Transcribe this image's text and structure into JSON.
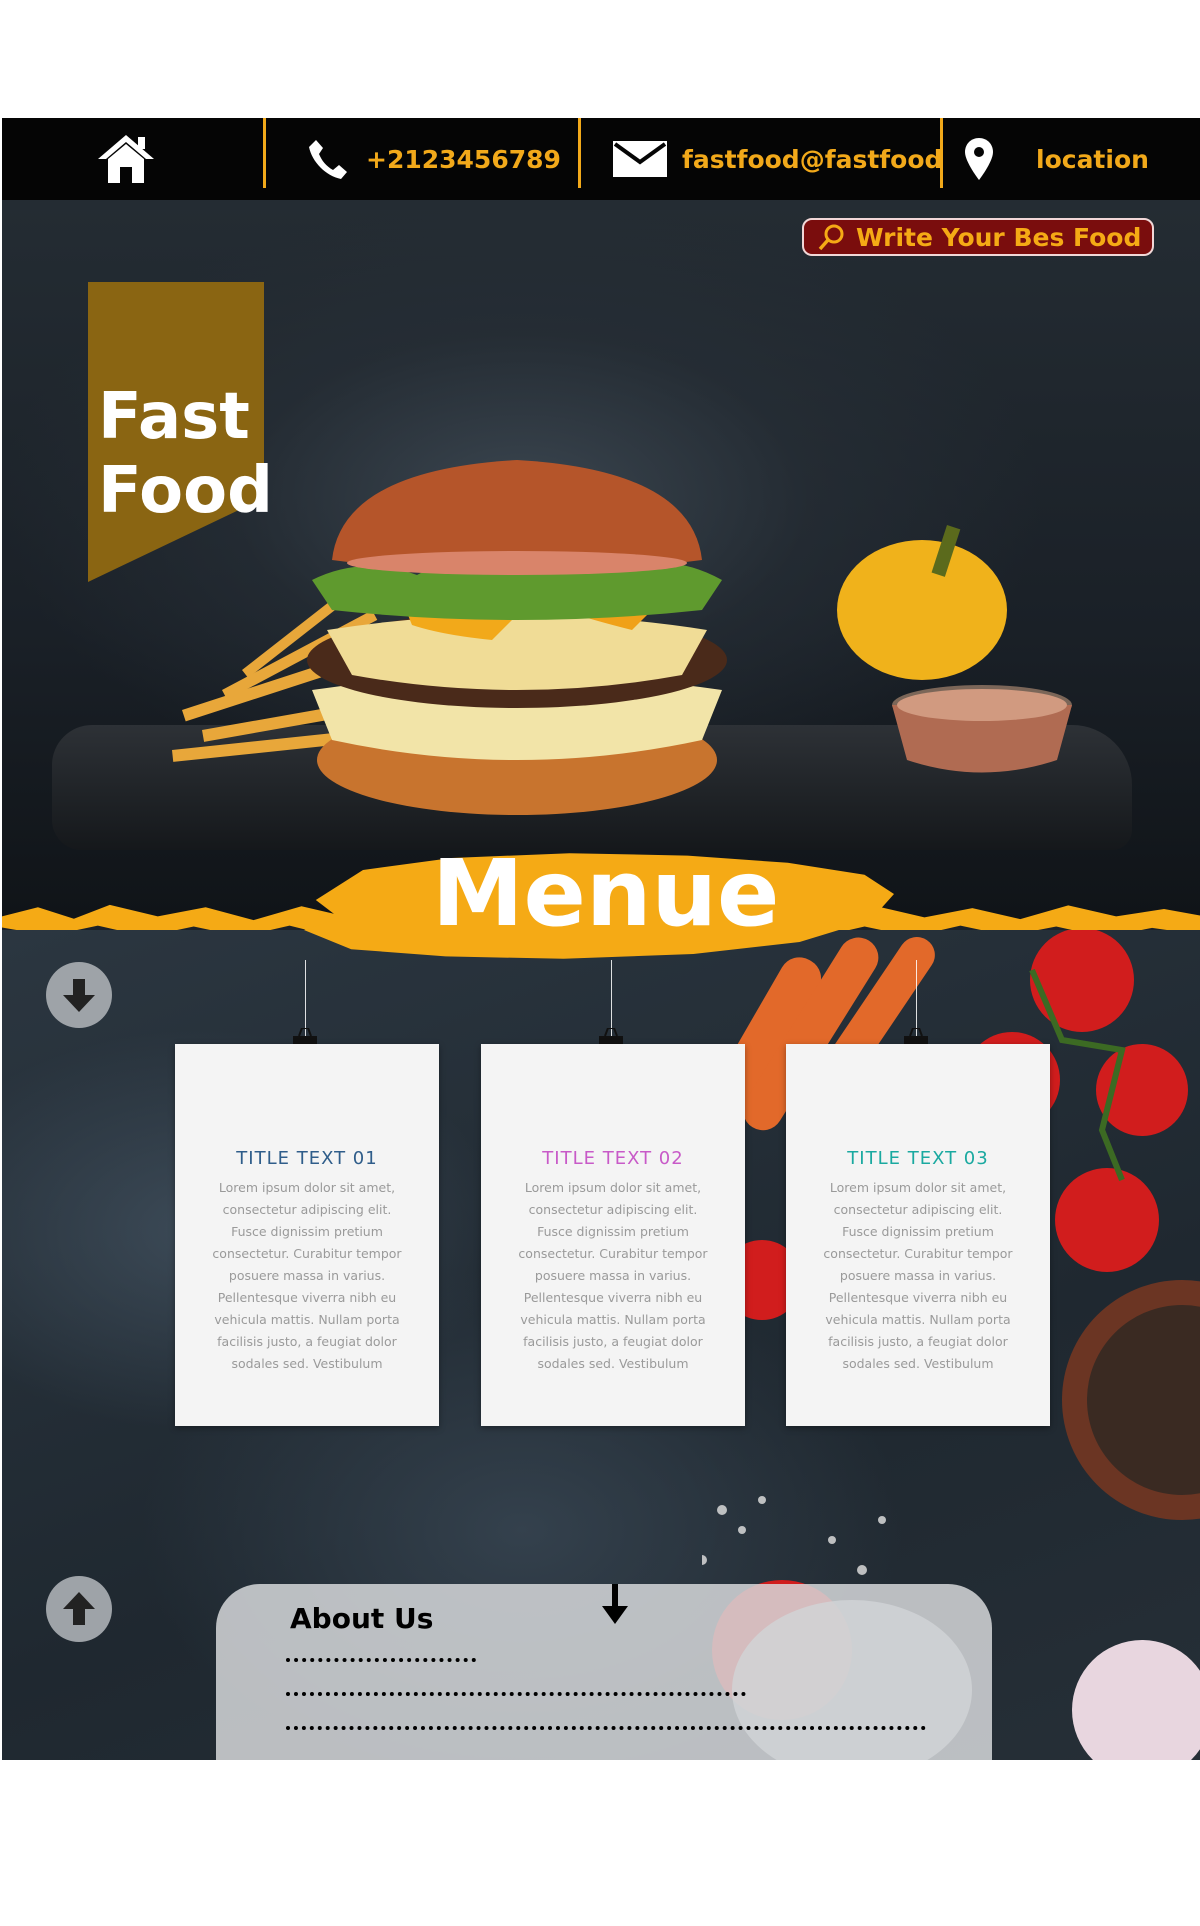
{
  "topbar": {
    "phone": "+2123456789",
    "email": "fastfood@fastfood",
    "location": "location"
  },
  "hero": {
    "brand_line1": "Fast",
    "brand_line2": "Food",
    "search_placeholder": "Write Your Bes Food"
  },
  "menu": {
    "title": "Menue",
    "cards": [
      {
        "title": "TITLE TEXT 01",
        "color": "#2f5d8a",
        "body": "Lorem ipsum dolor sit amet, consectetur adipiscing elit. Fusce dignissim pretium consectetur. Curabitur tempor posuere massa in varius. Pellentesque viverra nibh eu vehicula mattis. Nullam porta facilisis justo, a feugiat dolor sodales sed. Vestibulum"
      },
      {
        "title": "TITLE TEXT 02",
        "color": "#c85ac8",
        "body": "Lorem ipsum dolor sit amet, consectetur adipiscing elit. Fusce dignissim pretium consectetur. Curabitur tempor posuere massa in varius. Pellentesque viverra nibh eu vehicula mattis. Nullam porta facilisis justo, a feugiat dolor sodales sed. Vestibulum"
      },
      {
        "title": "TITLE TEXT 03",
        "color": "#1aa9a0",
        "body": "Lorem ipsum dolor sit amet, consectetur adipiscing elit. Fusce dignissim pretium consectetur. Curabitur tempor posuere massa in varius. Pellentesque viverra nibh eu vehicula mattis. Nullam porta facilisis justo, a feugiat dolor sodales sed. Vestibulum"
      }
    ]
  },
  "about": {
    "title": "About Us"
  },
  "colors": {
    "accent": "#f5aa15",
    "brand_banner": "#8a6512",
    "search_bg": "#7a0d0d"
  },
  "icons": [
    "home-icon",
    "phone-icon",
    "mail-icon",
    "location-pin-icon",
    "search-icon",
    "arrow-down-icon",
    "arrow-up-icon"
  ]
}
